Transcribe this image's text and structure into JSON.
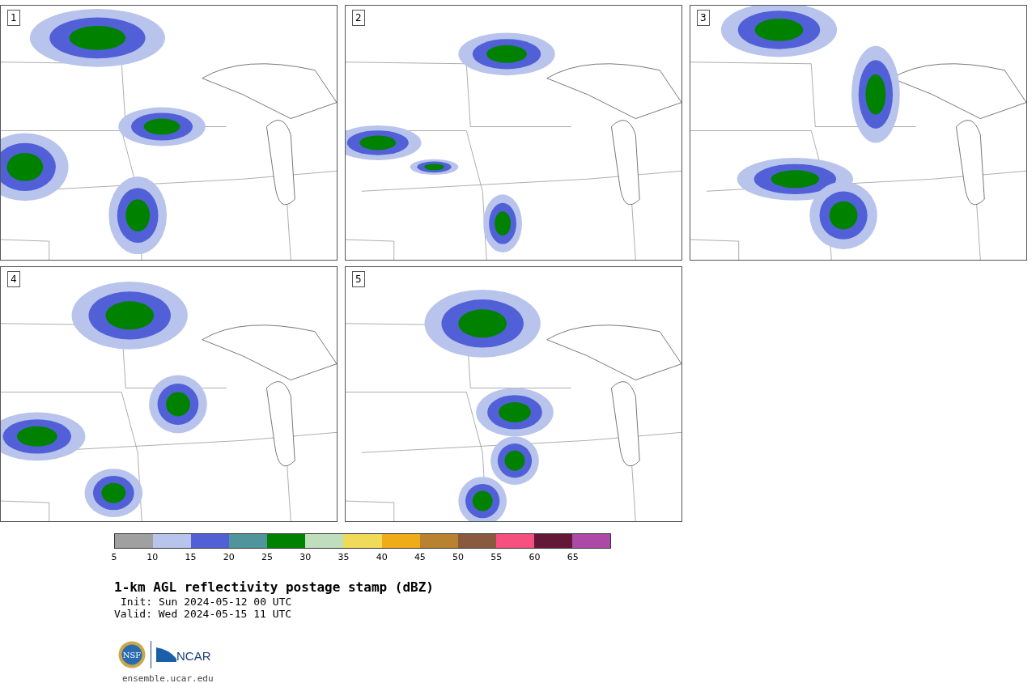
{
  "panels": [
    {
      "label": "1"
    },
    {
      "label": "2"
    },
    {
      "label": "3"
    },
    {
      "label": "4"
    },
    {
      "label": "5"
    }
  ],
  "colorbar": [
    {
      "tick": "5",
      "color": "#a0a0a0"
    },
    {
      "tick": "10",
      "color": "#b8c4ec"
    },
    {
      "tick": "15",
      "color": "#5260d8"
    },
    {
      "tick": "20",
      "color": "#4f959b"
    },
    {
      "tick": "25",
      "color": "#008200"
    },
    {
      "tick": "30",
      "color": "#bedebe"
    },
    {
      "tick": "35",
      "color": "#f0da5a"
    },
    {
      "tick": "40",
      "color": "#f0ac18"
    },
    {
      "tick": "45",
      "color": "#b98230"
    },
    {
      "tick": "50",
      "color": "#8a5a3e"
    },
    {
      "tick": "55",
      "color": "#f55080"
    },
    {
      "tick": "60",
      "color": "#641838"
    },
    {
      "tick": "65",
      "color": "#ad4aa8"
    }
  ],
  "title": "1-km AGL reflectivity postage stamp (dBZ)",
  "init": "Init: Sun 2024-05-12 00 UTC",
  "valid": "Valid: Wed 2024-05-15 11 UTC",
  "logos": {
    "nsf": "NSF",
    "ncar": "NCAR"
  },
  "footer": "ensemble.ucar.edu"
}
